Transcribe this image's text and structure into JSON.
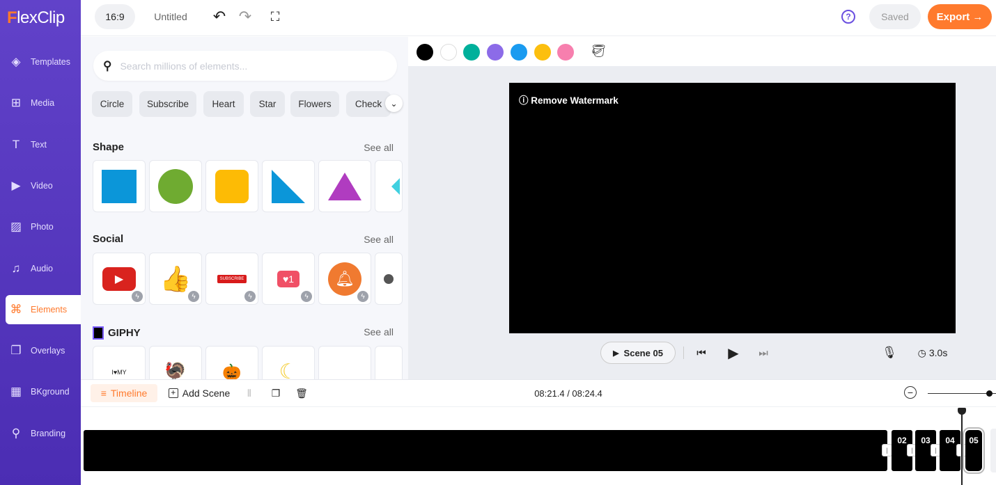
{
  "app": {
    "logo": "FlexClip",
    "brand_color": "#ff7a2d",
    "sidebar_color": "#5a3ec5"
  },
  "sidebar": {
    "items": [
      {
        "label": "Templates",
        "icon": "layers-icon",
        "glyph": "◈"
      },
      {
        "label": "Media",
        "icon": "media-icon",
        "glyph": "⊞"
      },
      {
        "label": "Text",
        "icon": "text-icon",
        "glyph": "T"
      },
      {
        "label": "Video",
        "icon": "video-icon",
        "glyph": "▶"
      },
      {
        "label": "Photo",
        "icon": "photo-icon",
        "glyph": "▨"
      },
      {
        "label": "Audio",
        "icon": "audio-icon",
        "glyph": "♫"
      },
      {
        "label": "Elements",
        "icon": "elements-icon",
        "glyph": "⌘",
        "active": true
      },
      {
        "label": "Overlays",
        "icon": "overlays-icon",
        "glyph": "❐"
      },
      {
        "label": "BKground",
        "icon": "background-icon",
        "glyph": "▦"
      },
      {
        "label": "Branding",
        "icon": "branding-icon",
        "glyph": "⚲"
      }
    ]
  },
  "topbar": {
    "ratio": "16:9",
    "title": "Untitled",
    "saved": "Saved",
    "export": "Export →",
    "help": "?"
  },
  "panel": {
    "search_placeholder": "Search millions of elements...",
    "tags": [
      "Circle",
      "Subscribe",
      "Heart",
      "Star",
      "Flowers",
      "Check"
    ],
    "sections": [
      {
        "title": "Shape",
        "see_all": "See all"
      },
      {
        "title": "Social",
        "see_all": "See all"
      },
      {
        "title": "GIPHY",
        "see_all": "See all"
      }
    ]
  },
  "colors": [
    "#000000",
    "#ffffff",
    "#00b09b",
    "#8c6be8",
    "#1a9bf0",
    "#fcbf0f",
    "#f77fae"
  ],
  "preview": {
    "watermark": "ⓘ Remove Watermark",
    "scene": "Scene 05",
    "duration": "3.0s"
  },
  "timeline": {
    "tab": "Timeline",
    "add_scene": "Add Scene",
    "time": "08:21.4 / 08:24.4",
    "zoom_level": 0.9,
    "clips": [
      "",
      "02",
      "03",
      "04",
      "05"
    ]
  }
}
